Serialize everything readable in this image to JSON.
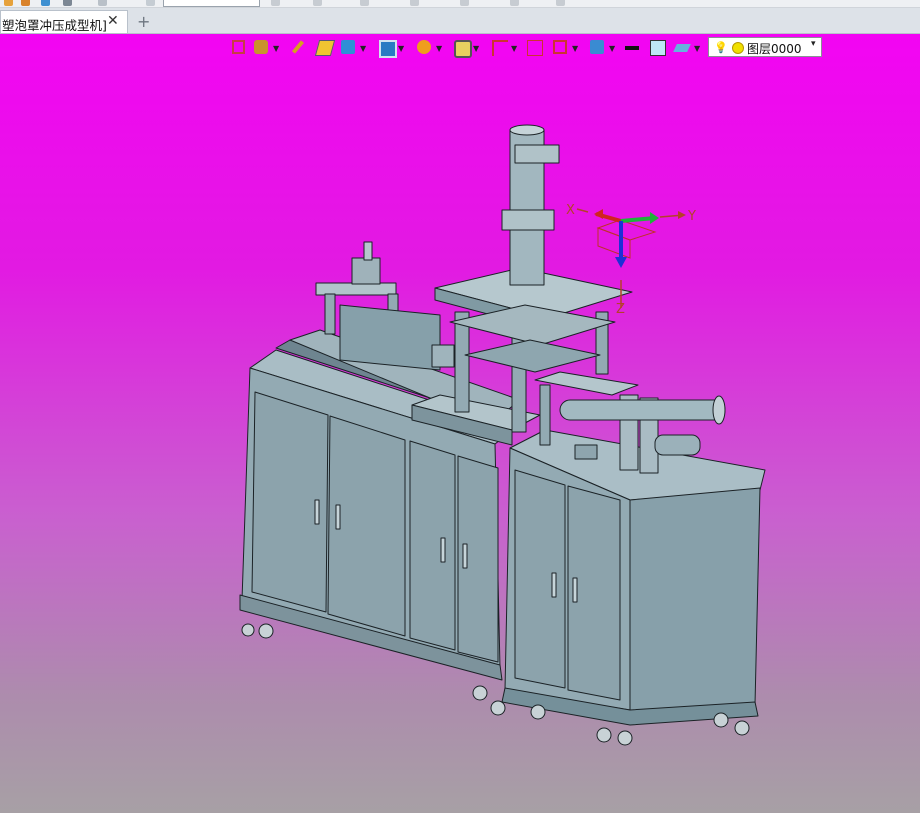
{
  "document_tab": {
    "title": "塑泡罩冲压成型机]",
    "close_glyph": "✕",
    "add_glyph": "+"
  },
  "top_toolbar": {
    "filter_combo_value": ""
  },
  "view_toolbar": {
    "icons": [
      "exit-sketch-icon",
      "snap-icon",
      "pen-icon",
      "eraser-icon",
      "cube-icon",
      "display-mode-icon",
      "render-icon",
      "view-orient-icon",
      "zoom-icon",
      "triad-icon",
      "section-icon",
      "measure-icon",
      "monitor-icon",
      "line-style-icon",
      "color-swatch-icon",
      "layer-plane-icon"
    ],
    "layer": {
      "name": "图层0000",
      "caret": "▾"
    }
  },
  "triad": {
    "x_label": "X",
    "y_label": "Y",
    "z_label": "Z"
  },
  "colors": {
    "viewport_top": "#f304f3",
    "viewport_bottom": "#a7a0a5",
    "model_body": "#93aab3",
    "model_edge": "#1b2226"
  }
}
